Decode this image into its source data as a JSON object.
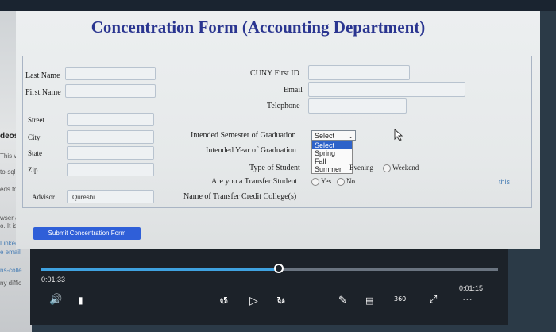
{
  "form": {
    "title": "Concentration Form (Accounting Department)",
    "left_fields": [
      {
        "label": "Last Name",
        "value": ""
      },
      {
        "label": "First Name",
        "value": ""
      },
      {
        "label": "Street",
        "value": ""
      },
      {
        "label": "City",
        "value": ""
      },
      {
        "label": "State",
        "value": ""
      },
      {
        "label": "Zip",
        "value": ""
      },
      {
        "label": "Advisor",
        "value": "Qureshi"
      }
    ],
    "right_fields": {
      "cuny_id": "CUNY First ID",
      "email": "Email",
      "telephone": "Telephone",
      "semester": "Intended Semester of Graduation",
      "year": "Intended Year of Graduation",
      "student_type": "Type of Student",
      "transfer": "Are you a Transfer Student",
      "transfer_colleges": "Name of Transfer Credit College(s)"
    },
    "semester_select": {
      "selected": "Select",
      "options": [
        "Select",
        "Spring",
        "Fall",
        "Summer"
      ]
    },
    "student_type_options": [
      "Evening",
      "Weekend"
    ],
    "transfer_options": [
      "Yes",
      "No"
    ],
    "submit_label": "Submit Concentration Form",
    "side_note": "this"
  },
  "background": {
    "fragments": [
      "deos",
      "This v",
      "to-sql",
      "eds to",
      "wser an",
      "o. It is",
      "Linkedin",
      "e email",
      "ns-colle",
      "ny diffic"
    ]
  },
  "player": {
    "current_time": "0:01:33",
    "duration": "0:01:15",
    "progress_fraction": 0.52,
    "skip_back": "10",
    "skip_forward": "30",
    "speed": "360"
  },
  "colors": {
    "title": "#2a3590",
    "submit": "#2f5fd8",
    "dropdown_highlight": "#2e63c9",
    "progress": "#3fa2e0"
  }
}
